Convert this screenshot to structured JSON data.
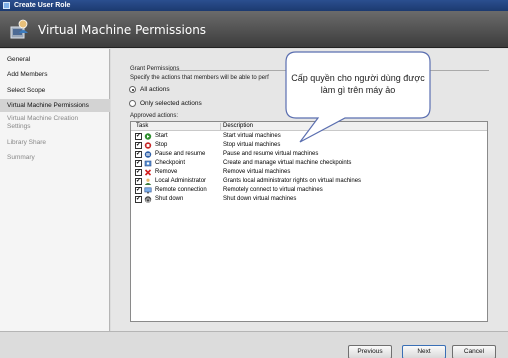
{
  "window": {
    "title": "Create User Role"
  },
  "header": {
    "title": "Virtual Machine Permissions"
  },
  "sidebar": {
    "items": [
      {
        "label": "General",
        "state": "normal"
      },
      {
        "label": "Add Members",
        "state": "normal"
      },
      {
        "label": "Select Scope",
        "state": "normal"
      },
      {
        "label": "Virtual Machine Permissions",
        "state": "active"
      },
      {
        "label": "Virtual Machine Creation Settings",
        "state": "dim"
      },
      {
        "label": "Library Share",
        "state": "dim"
      },
      {
        "label": "Summary",
        "state": "dim"
      }
    ]
  },
  "grant": {
    "group_label": "Grant Permissions",
    "description": "Specify the actions that members will be able to perf",
    "options": [
      {
        "label": "All actions",
        "selected": true
      },
      {
        "label": "Only selected actions",
        "selected": false
      }
    ],
    "approved_label": "Approved actions:"
  },
  "table": {
    "columns": {
      "task": "Task",
      "description": "Description"
    },
    "rows": [
      {
        "task": "Start",
        "description": "Start virtual machines",
        "icon": "start-icon",
        "checked": true
      },
      {
        "task": "Stop",
        "description": "Stop virtual machines",
        "icon": "stop-icon",
        "checked": true
      },
      {
        "task": "Pause and resume",
        "description": "Pause and resume virtual machines",
        "icon": "pause-icon",
        "checked": true
      },
      {
        "task": "Checkpoint",
        "description": "Create and manage virtual machine checkpoints",
        "icon": "checkpoint-icon",
        "checked": true
      },
      {
        "task": "Remove",
        "description": "Remove virtual machines",
        "icon": "remove-icon",
        "checked": true
      },
      {
        "task": "Local Administrator",
        "description": "Grants local administrator rights on virtual machines",
        "icon": "admin-icon",
        "checked": true
      },
      {
        "task": "Remote connection",
        "description": "Remotely connect to virtual machines",
        "icon": "remote-icon",
        "checked": true
      },
      {
        "task": "Shut down",
        "description": "Shut down virtual machines",
        "icon": "shutdown-icon",
        "checked": true
      }
    ]
  },
  "callout": {
    "text": "Cấp quyền cho người dùng được làm gì trên máy ảo"
  },
  "footer": {
    "previous": "Previous",
    "next": "Next",
    "cancel": "Cancel"
  }
}
